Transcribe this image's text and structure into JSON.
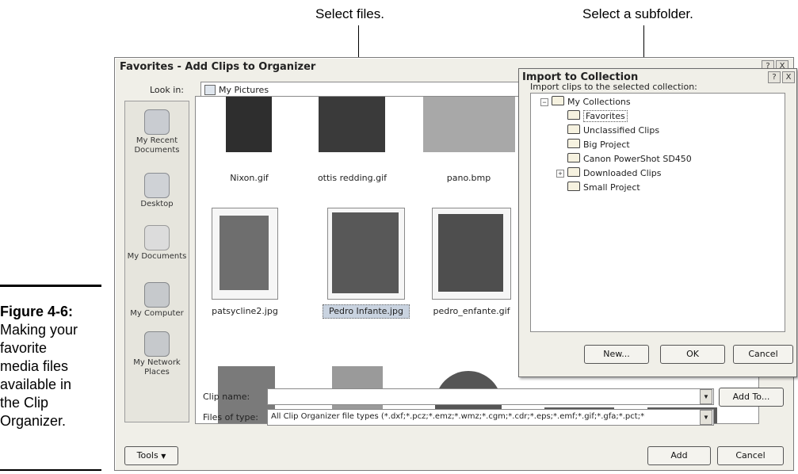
{
  "callouts": {
    "select_files": "Select files.",
    "select_subfolder": "Select a subfolder."
  },
  "caption": {
    "figure": "Figure 4-6:",
    "line1": "Making your",
    "line2": "favorite",
    "line3": "media files",
    "line4": "available in",
    "line5": "the Clip",
    "line6": "Organizer."
  },
  "dialog": {
    "title": "Favorites - Add Clips to Organizer",
    "title_buttons": {
      "help": "?",
      "close": "X"
    },
    "look_in_label": "Look in:",
    "look_in_value": "My Pictures",
    "places": [
      {
        "label1": "My Recent",
        "label2": "Documents"
      },
      {
        "label1": "Desktop",
        "label2": ""
      },
      {
        "label1": "My Documents",
        "label2": ""
      },
      {
        "label1": "My Computer",
        "label2": ""
      },
      {
        "label1": "My Network",
        "label2": "Places"
      }
    ],
    "files": [
      {
        "name": "Nixon.gif"
      },
      {
        "name": "ottis redding.gif"
      },
      {
        "name": "pano.bmp"
      },
      {
        "name": "patsycline2.jpg"
      },
      {
        "name": "Pedro Infante.jpg"
      },
      {
        "name": "pedro_enfante.gif"
      }
    ],
    "clip_name_label": "Clip name:",
    "clip_name_value": "",
    "files_of_type_label": "Files of type:",
    "files_of_type_value": "All Clip Organizer file types  (*.dxf;*.pcz;*.emz;*.wmz;*.cgm;*.cdr;*.eps;*.emf;*.gif;*.gfa;*.pct;*",
    "add_to_label": "Add To...",
    "tools_label": "Tools",
    "add_label": "Add",
    "cancel_label": "Cancel"
  },
  "import": {
    "title": "Import to Collection",
    "title_buttons": {
      "help": "?",
      "close": "X"
    },
    "prompt": "Import clips to the selected collection:",
    "tree": [
      "My Collections",
      "Favorites",
      "Unclassified Clips",
      "Big Project",
      "Canon PowerShot SD450",
      "Downloaded Clips",
      "Small Project"
    ],
    "expand_collapse": {
      "root": "−",
      "downloaded": "+"
    },
    "new_label": "New...",
    "ok_label": "OK",
    "cancel_label": "Cancel"
  },
  "colors": {
    "dialog_bg": "#f0efe8",
    "selection": "#c9d3e0",
    "frame": "#7a7a7a"
  }
}
